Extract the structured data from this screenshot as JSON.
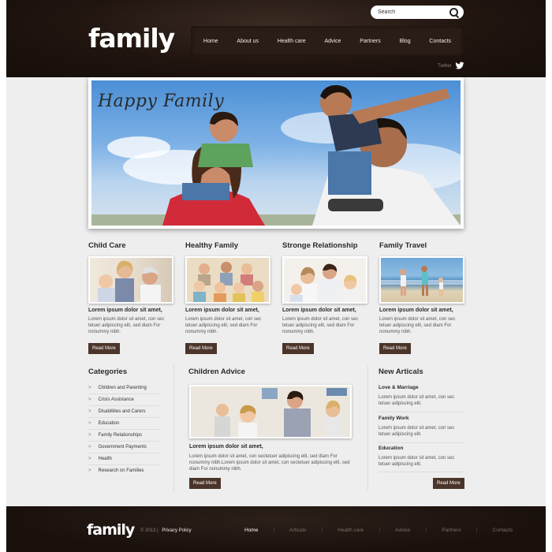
{
  "header": {
    "logo": "family",
    "search_placeholder": "Search",
    "nav": [
      "Home",
      "About us",
      "Health care",
      "Advice",
      "Partners",
      "Blog",
      "Contacts"
    ],
    "twitter_label": "Twitter"
  },
  "hero": {
    "title": "Happy Family"
  },
  "features": [
    {
      "title": "Child Care",
      "subtitle": "Lorem ipsum dolor sit amet,",
      "text": "Lorem ipsum dolor sit amet, con sec tetuer adipiscing elit, sed diam For nonummy nibh.",
      "button": "Read More"
    },
    {
      "title": "Healthy Family",
      "subtitle": "Lorem ipsum dolor sit amet,",
      "text": "Lorem ipsum dolor sit amet, con sec tetuer adipiscing elit, sed diam For nonummy nibh.",
      "button": "Read More"
    },
    {
      "title": "Stronge Relationship",
      "subtitle": "Lorem ipsum dolor sit amet,",
      "text": "Lorem ipsum dolor sit amet, con sec tetuer adipiscing elit, sed diam For nonummy nibh.",
      "button": "Read More"
    },
    {
      "title": "Family Travel",
      "subtitle": "Lorem ipsum dolor sit amet,",
      "text": "Lorem ipsum dolor sit amet, con sec tetuer adipiscing elit, sed diam For nonummy nibh.",
      "button": "Read More"
    }
  ],
  "categories": {
    "title": "Categories",
    "items": [
      "Children and Parenting",
      "Crisis Assistance",
      "Disabilities and Carers",
      "Education",
      "Family Relationships",
      "Government Payments",
      "Health",
      "Research on Families"
    ]
  },
  "advice": {
    "title": "Children Advice",
    "subtitle": "Lorem ipsum dolor sit amet,",
    "text": "Lorem ipsum dolor sit amet, con sectetuer adipiscing elit, sed diam For nonummy nibh.Lorem ipsum dolor sit amet, con sectetuer adipiscing elit, sed diam For nonummy nibh.",
    "button": "Read More"
  },
  "news": {
    "title": "New Articals",
    "items": [
      {
        "title": "Love & Marriage",
        "text": "Lorem ipsum dolor sit amet, con sec tetuer adipiscing elit."
      },
      {
        "title": "Family Work",
        "text": "Lorem ipsum dolor sit amet, con sec tetuer adipiscing elit."
      },
      {
        "title": "Education",
        "text": "Lorem ipsum dolor sit amet, con sec tetuer adipiscing elit."
      }
    ],
    "button": "Read More"
  },
  "footer": {
    "logo": "family",
    "copyright": "© 2013",
    "separator": "|",
    "privacy": "Privacy Policy",
    "nav": [
      "Home",
      "Articals",
      "Health care",
      "Advice",
      "Partners",
      "Contacts"
    ]
  },
  "colors": {
    "header_bg": "#1e130e",
    "button_bg": "#4b3429",
    "content_bg": "#eeeeee"
  }
}
